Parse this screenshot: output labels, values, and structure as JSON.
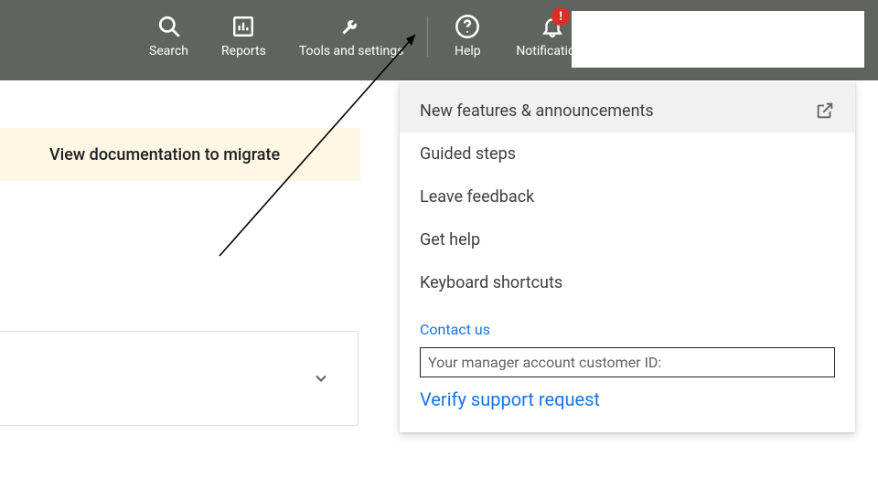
{
  "nav": {
    "search": "Search",
    "reports": "Reports",
    "tools": "Tools and settings",
    "help": "Help",
    "notifications": "Notifications",
    "badge": "!"
  },
  "banner": {
    "text": "View documentation to migrate"
  },
  "help_menu": {
    "announcements": "New features & announcements",
    "guided": "Guided steps",
    "feedback": "Leave feedback",
    "gethelp": "Get help",
    "shortcuts": "Keyboard shortcuts",
    "contact_heading": "Contact us",
    "customer_id_label": "Your manager account customer ID:",
    "verify": "Verify support request"
  }
}
